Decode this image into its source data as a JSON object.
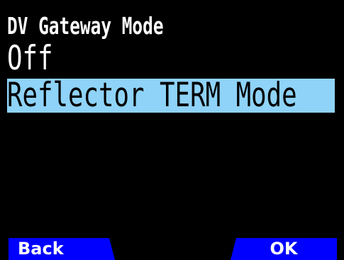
{
  "screen": {
    "title": "DV Gateway Mode",
    "options": [
      {
        "label": "Off",
        "selected": false
      },
      {
        "label": "Reflector TERM Mode",
        "selected": true
      }
    ],
    "softkeys": {
      "left": "Back",
      "right": "OK"
    }
  },
  "colors": {
    "background": "#000000",
    "text": "#ffffff",
    "selection_highlight": "#8fd3f8",
    "softkey_background": "#0000ff"
  }
}
